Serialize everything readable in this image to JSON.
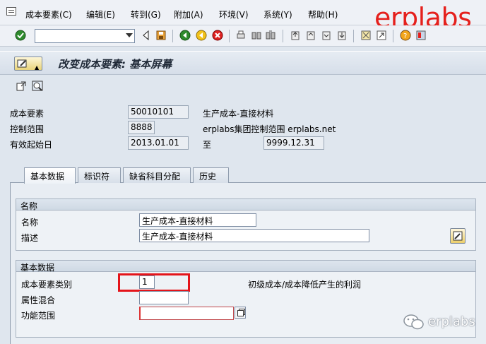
{
  "menu": {
    "items": [
      "成本要素(C)",
      "编辑(E)",
      "转到(G)",
      "附加(A)",
      "环境(V)",
      "系统(Y)",
      "帮助(H)"
    ]
  },
  "watermark": "erplabs",
  "toolbar": {
    "command_value": "",
    "icons": [
      "enter-icon",
      "back-icon",
      "save-icon",
      "back-green-icon",
      "exit-icon",
      "cancel-icon",
      "print-icon",
      "find-icon",
      "find-next-icon",
      "first-page-icon",
      "prev-page-icon",
      "next-page-icon",
      "last-page-icon",
      "new-session-icon",
      "shortcut-icon",
      "help-icon",
      "layout-icon"
    ]
  },
  "title": "改变成本要素: 基本屏幕",
  "header": {
    "cost_element_label": "成本要素",
    "cost_element_value": "50010101",
    "cost_element_desc": "生产成本-直接材料",
    "controlling_area_label": "控制范围",
    "controlling_area_value": "8888",
    "controlling_area_desc": "erplabs集团控制范围 erplabs.net",
    "valid_from_label": "有效起始日",
    "valid_from_value": "2013.01.01",
    "valid_to_label": "至",
    "valid_to_value": "9999.12.31"
  },
  "tabs": [
    "基本数据",
    "标识符",
    "缺省科目分配",
    "历史"
  ],
  "names_group": {
    "title": "名称",
    "name_label": "名称",
    "name_value": "生产成本-直接材料",
    "desc_label": "描述",
    "desc_value": "生产成本-直接材料"
  },
  "basic_group": {
    "title": "基本数据",
    "category_label": "成本要素类别",
    "category_value": "1",
    "category_desc": "初级成本/成本降低产生的利润",
    "attr_label": "属性混合",
    "attr_value": "",
    "func_label": "功能范围",
    "func_value": ""
  },
  "wechat_brand": "erplabs",
  "colors": {
    "accent_red": "#e4141a",
    "watermark_red": "#e5201c"
  }
}
